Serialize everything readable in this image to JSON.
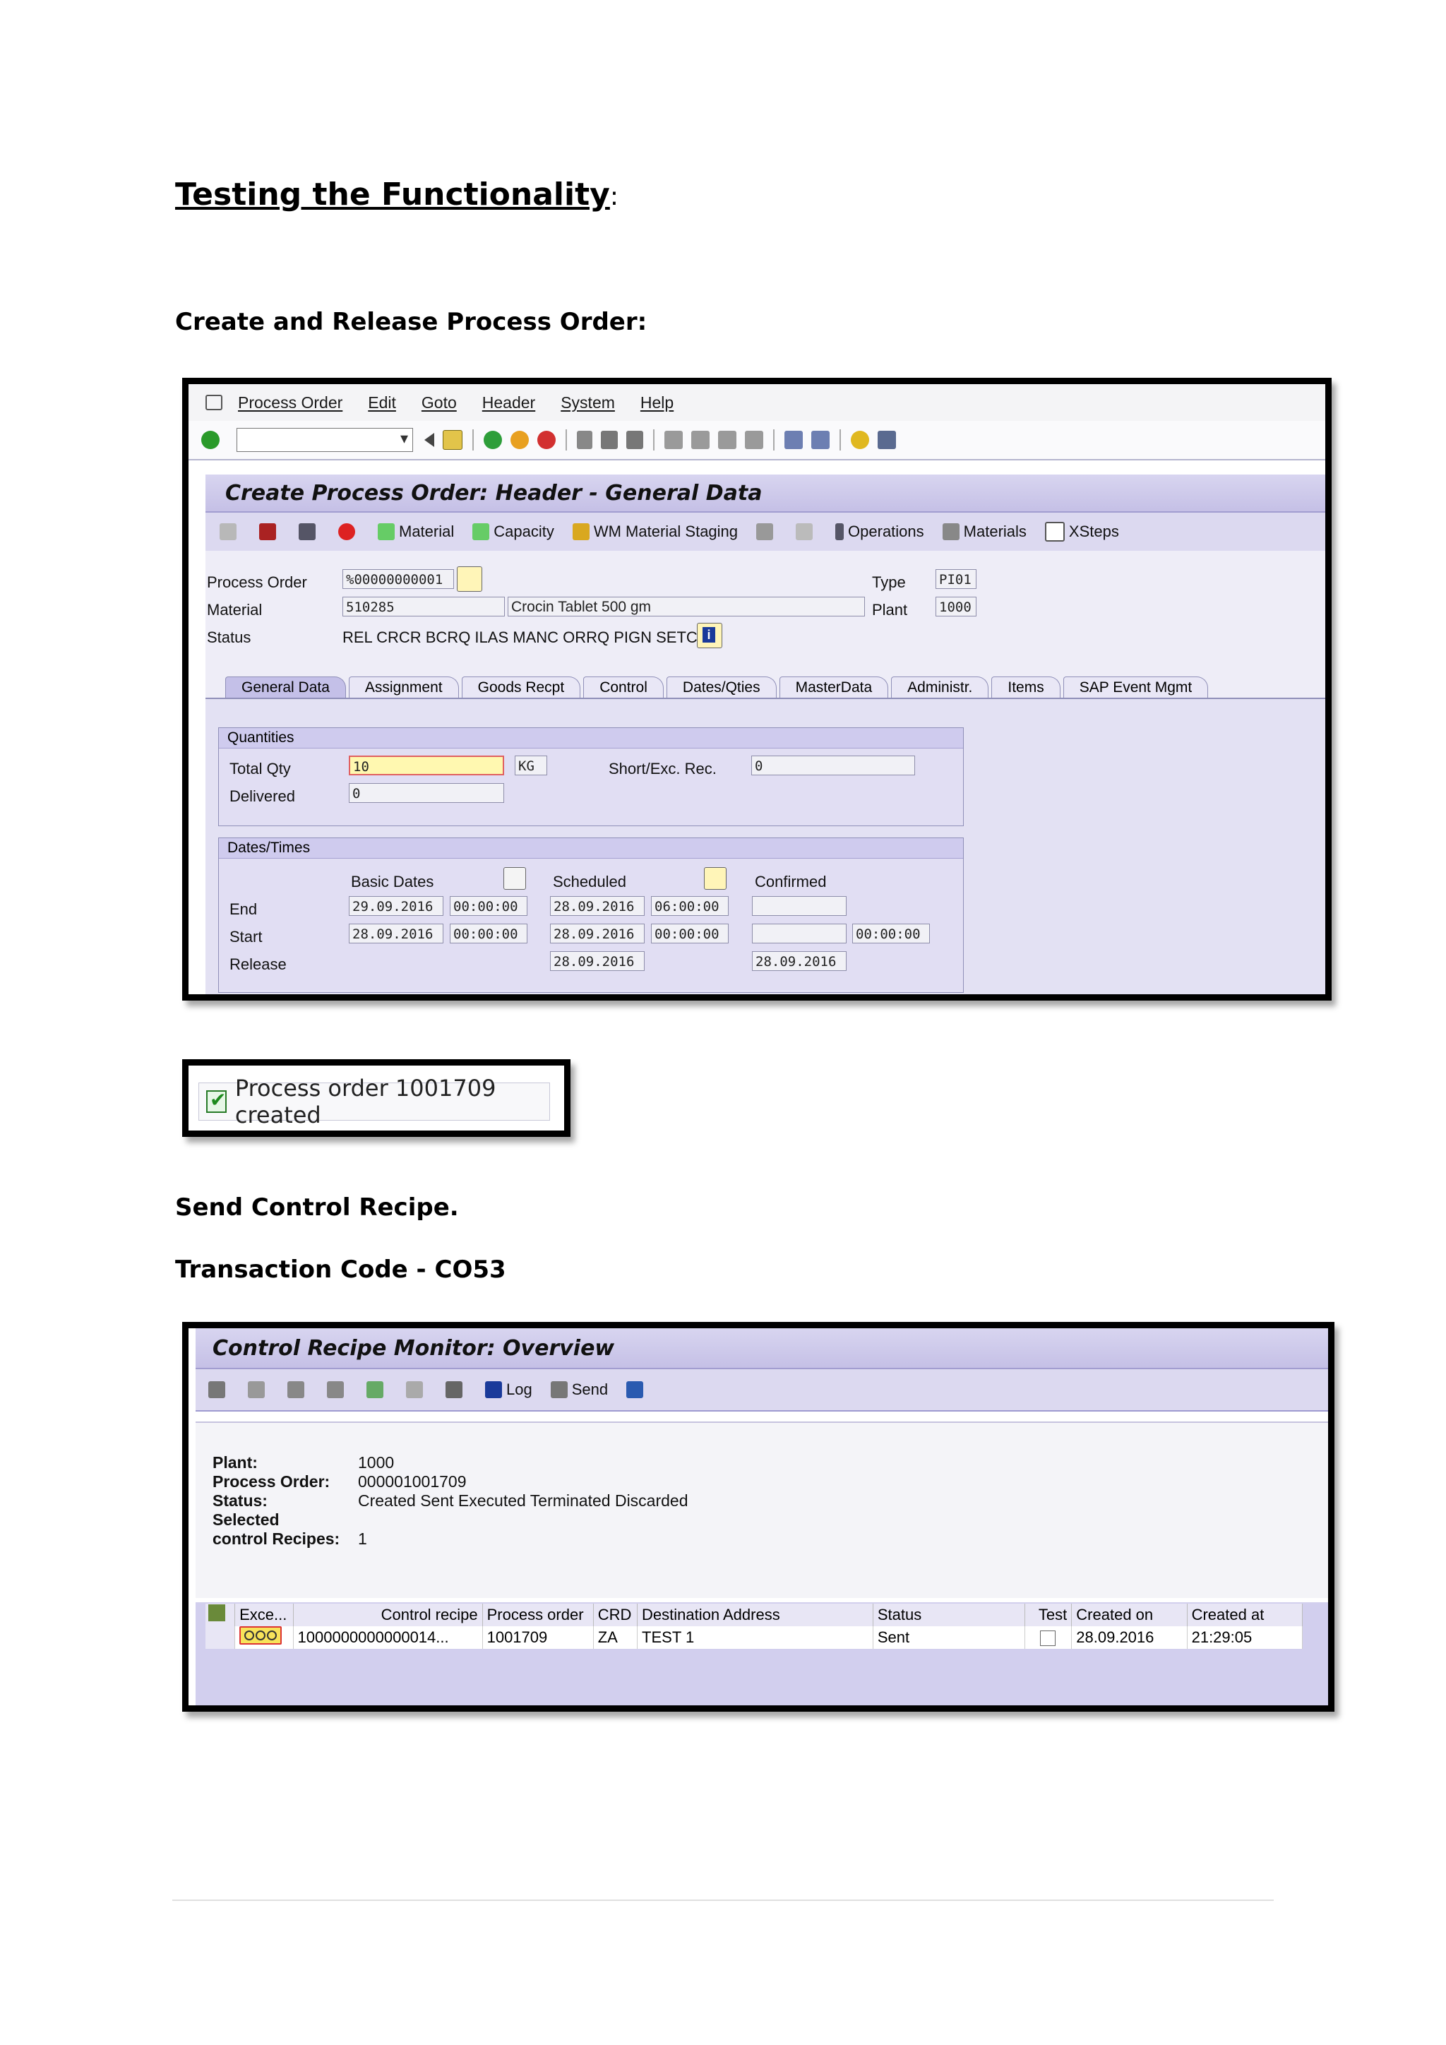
{
  "doc": {
    "title": "Testing the Functionality",
    "title_colon": ":",
    "section1": "Create and Release Process Order:",
    "section2": "Send Control Recipe.",
    "section3": "Transaction Code - CO53"
  },
  "sap1": {
    "menu": [
      "Process Order",
      "Edit",
      "Goto",
      "Header",
      "System",
      "Help"
    ],
    "title": "Create Process Order: Header - General Data",
    "app_toolbar": [
      "Material",
      "Capacity",
      "WM Material Staging",
      "Operations",
      "Materials",
      "XSteps"
    ],
    "header": {
      "process_order_label": "Process Order",
      "process_order_value": "%00000000001",
      "type_label": "Type",
      "type_value": "PI01",
      "material_label": "Material",
      "material_value": "510285",
      "material_desc": "Crocin Tablet 500 gm",
      "plant_label": "Plant",
      "plant_value": "1000",
      "status_label": "Status",
      "status_value": "REL  CRCR BCRQ ILAS MANC ORRQ PIGN SETC"
    },
    "tabs": [
      "General Data",
      "Assignment",
      "Goods Recpt",
      "Control",
      "Dates/Qties",
      "MasterData",
      "Administr.",
      "Items",
      "SAP Event Mgmt"
    ],
    "quantities": {
      "title": "Quantities",
      "total_qty_label": "Total Qty",
      "total_qty_value": "10",
      "unit": "KG",
      "short_exc_label": "Short/Exc. Rec.",
      "short_exc_value": "0",
      "delivered_label": "Delivered",
      "delivered_value": "0"
    },
    "dates": {
      "title": "Dates/Times",
      "basic_dates": "Basic Dates",
      "scheduled": "Scheduled",
      "confirmed": "Confirmed",
      "end_label": "End",
      "start_label": "Start",
      "release_label": "Release",
      "end_basic_date": "29.09.2016",
      "end_basic_time": "00:00:00",
      "end_sched_date": "28.09.2016",
      "end_sched_time": "06:00:00",
      "start_basic_date": "28.09.2016",
      "start_basic_time": "00:00:00",
      "start_sched_date": "28.09.2016",
      "start_sched_time": "00:00:00",
      "start_conf_time": "00:00:00",
      "release_sched_date": "28.09.2016",
      "release_conf_date": "28.09.2016"
    }
  },
  "message": "Process order 1001709 created",
  "sap2": {
    "title": "Control Recipe Monitor: Overview",
    "toolbar": [
      "Log",
      "Send"
    ],
    "info": {
      "plant_label": "Plant:",
      "plant_value": "1000",
      "po_label": "Process Order:",
      "po_value": "000001001709",
      "status_label": "Status:",
      "status_value": "Created Sent Executed Terminated Discarded",
      "selected_label": "Selected",
      "recipes_label": "control Recipes:",
      "recipes_value": "1"
    },
    "columns": [
      "Exce...",
      "Control recipe",
      "Process order",
      "CRD",
      "Destination Address",
      "Status",
      "Test",
      "Created on",
      "Created at"
    ],
    "row": {
      "control_recipe": "1000000000000014...",
      "process_order": "1001709",
      "crd": "ZA",
      "destination": "TEST 1",
      "status": "Sent",
      "created_on": "28.09.2016",
      "created_at": "21:29:05"
    }
  }
}
